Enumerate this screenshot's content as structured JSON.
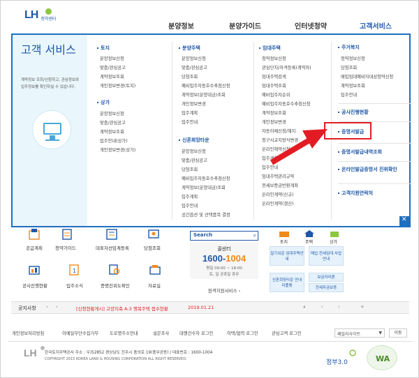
{
  "header": {
    "logo_text": "LH",
    "logo_sub": "청약센터",
    "nav": [
      "분양정보",
      "분양가이드",
      "인터넷청약",
      "고객서비스"
    ]
  },
  "mega_menu": {
    "side_title": "고객 서비스",
    "side_desc": "계약정보 조회/신청하고, 관심정보와 입주정보를 확인하실 수 있습니다.",
    "col1": {
      "groups": [
        {
          "title": "토지",
          "items": [
            "분양정보신청",
            "맞춤/관심공고",
            "계약정보조회",
            "개인정보변경(토지)"
          ]
        },
        {
          "title": "상가",
          "items": [
            "분양정보신청",
            "맞춤/관심공고",
            "계약정보조회",
            "입주안내(상가)",
            "개인정보변경(상가)"
          ]
        }
      ]
    },
    "col2": {
      "groups": [
        {
          "title": "분양주택",
          "items": [
            "분양정보신청",
            "맞춤/관심공고",
            "당첨조회",
            "예비입주자동호수추첨신청",
            "계약정보(분양대금)조회",
            "개인정보변경",
            "입주계획",
            "입주안내"
          ]
        },
        {
          "title": "신혼희망타운",
          "items": [
            "분양정보신청",
            "맞춤/관심공고",
            "당첨조회",
            "예비입주자동호수추첨신청",
            "계약정보(분양대금)조회",
            "입주계획",
            "입주안내",
            "공간옵션 및 선택품목 결정"
          ]
        }
      ]
    },
    "col3": {
      "groups": [
        {
          "title": "임대주택",
          "items": [
            "청약정보신청",
            "관심단지/자격등록(계약자)",
            "임대주택검색",
            "임대주택조회",
            "예비입주자순위",
            "예비입주자동호수추첨신청",
            "계약정보조회",
            "개인정보변경",
            "자동이체신청/해지",
            "청구서교지방식변경",
            "온라인해약신청",
            "입주계획",
            "입주안내",
            "임대주택관리규약",
            "전세보증금반환계좌",
            "온라인계약(신규)",
            "온라인계약(갱신)"
          ]
        }
      ]
    },
    "col4": {
      "housing_title": "주거복지",
      "housing_items": [
        "청약정보신청",
        "당첨조회",
        "매입임대예비자대상청약신청",
        "계약정보조회",
        "입주안내"
      ],
      "items": [
        "공사진행현황",
        "증명서발급",
        "증명서발급내역조회",
        "온라인발급증명서 진위확인",
        "고객지원연락처"
      ]
    }
  },
  "quick_icons": [
    "공급계획",
    "청약가이드",
    "대표자선임계등록",
    "당첨조회",
    "공사진행현황",
    "입주소식",
    "증명진위도확인",
    "자료실"
  ],
  "search": {
    "label": "Search",
    "call_title": "콜센터",
    "call_num_a": "1600-",
    "call_num_b": "1004",
    "hours": "평일 09:00 ~ 18:00",
    "hours2": "토, 일 공휴일 휴무",
    "remote": "원격지원서비스 ›"
  },
  "right_icons": [
    "토지",
    "주택",
    "상가"
  ],
  "right_boxes": [
    "알기쉬운 임대주택안내",
    "매입·전세임대 사업안내",
    "신혼희망타운 안내 리플렛",
    "보금자리론",
    "전세자금보증"
  ],
  "notice": {
    "label": "공지사항",
    "message": "[신청현황게시] 고양지축 A-3 행복주택 접수현황",
    "date": "2019.01.21"
  },
  "footer": {
    "links": [
      "개인정보처리방침",
      "이메일무단수집거부",
      "도로명주소안내",
      "설문조사",
      "대행건수자 로그인",
      "이택/협력 로그인",
      "관심고객 로그인"
    ],
    "family_site": "패밀리사이트",
    "go": "이동",
    "logo": "LH",
    "address": "한국토지주택공사  주소 : 우)52852 경상남도 진주시 충의로 19(충무공동) / 대표번호 : 1600-1004",
    "copyright": "COPYRIGHT 2015 KOREA LAND & HOUSING CORPORATION ALL RIGHT RESERVED.",
    "gov_text": "정부3.0",
    "wa_text": "WA"
  }
}
